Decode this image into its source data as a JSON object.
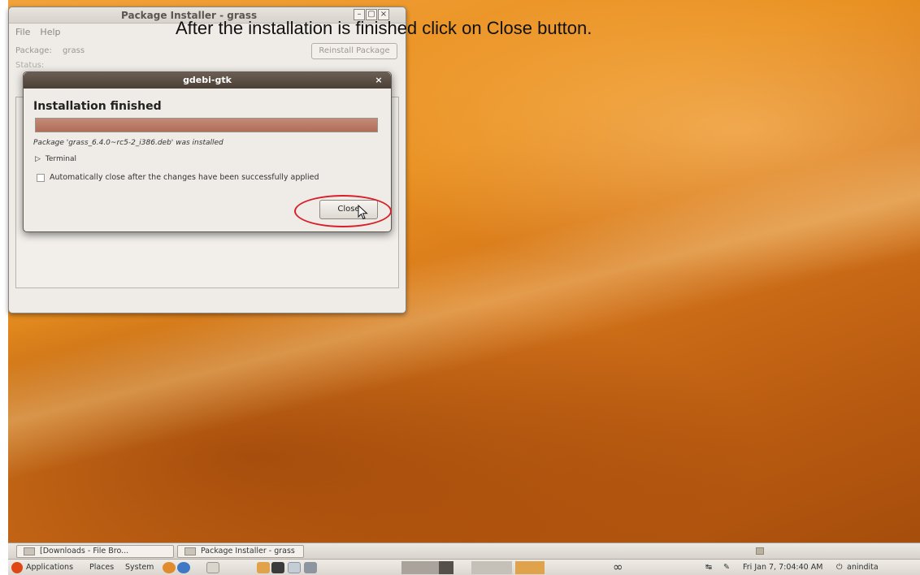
{
  "instruction": "After the installation is finished click on Close button.",
  "package_installer": {
    "title": "Package Installer - grass",
    "menu": [
      "File",
      "Help"
    ],
    "package_label": "Package:",
    "package_value": "grass",
    "reinstall_label": "Reinstall Package",
    "status_label": "Status:",
    "window_controls": [
      "minimize-icon",
      "maximize-icon",
      "close-icon"
    ]
  },
  "gdebi": {
    "title": "gdebi-gtk",
    "heading": "Installation finished",
    "progress": 1.0,
    "message": "Package 'grass_6.4.0~rc5-2_i386.deb' was installed",
    "terminal_label": "Terminal",
    "auto_close_label": "Automatically close after the changes have been successfully applied",
    "auto_close_checked": false,
    "close_label": "Close"
  },
  "taskbar": {
    "tasks": [
      "[Downloads - File Bro...",
      "Package Installer - grass"
    ]
  },
  "top_panel": {
    "menus": [
      "Applications",
      "Places",
      "System"
    ],
    "clock": "Fri Jan 7, 7:04:40 AM",
    "user": "anindita",
    "infinity": "∞"
  },
  "colors": {
    "desktop_orange": "#e88f1f",
    "highlight_red": "#d9202a",
    "gdebi_title_brown": "#4a3f36",
    "progress_fill": "#b06d58"
  }
}
